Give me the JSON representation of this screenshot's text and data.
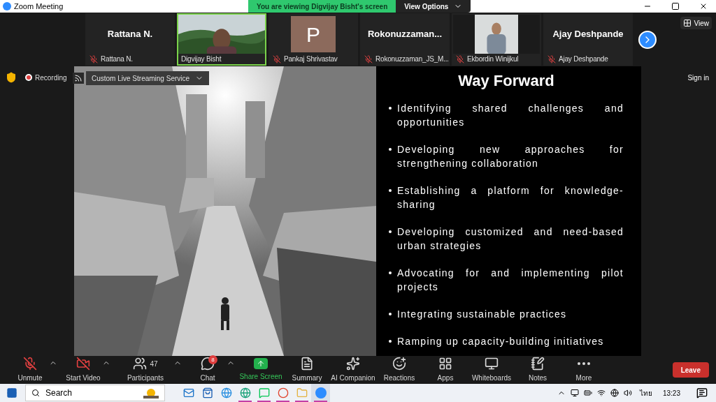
{
  "window": {
    "title": "Zoom Meeting",
    "banner": "You are viewing Digvijay Bisht's screen",
    "view_options": "View Options"
  },
  "gallery": {
    "view_button": "View",
    "tiles": [
      {
        "kind": "name",
        "display": "Rattana N.",
        "name": "Rattana N.",
        "muted": true,
        "speaking": false
      },
      {
        "kind": "video",
        "name": "Digvijay Bisht",
        "muted": false,
        "speaking": true
      },
      {
        "kind": "avatar",
        "display": "P",
        "name": "Pankaj Shrivastav",
        "muted": true,
        "speaking": false
      },
      {
        "kind": "name",
        "display": "Rokonuzzaman...",
        "name": "Rokonuzzaman_JS_M...",
        "muted": true,
        "speaking": false
      },
      {
        "kind": "video",
        "name": "Ekbordin Winijkul",
        "muted": true,
        "speaking": false
      },
      {
        "kind": "name",
        "display": "Ajay Deshpande",
        "name": "Ajay Deshpande",
        "muted": true,
        "speaking": false
      }
    ]
  },
  "share": {
    "recording": "Recording",
    "stream_service": "Custom Live Streaming Service",
    "sign_in": "Sign in"
  },
  "slide": {
    "title": "Way Forward",
    "bullets": [
      "Identifying shared challenges and opportunities",
      "Developing new approaches for strengthening collaboration",
      "Establishing a platform for knowledge-sharing",
      "Developing customized and need-based urban strategies",
      "Advocating for and implementing pilot projects",
      "Integrating sustainable practices",
      "Ramping up capacity-building initiatives"
    ]
  },
  "toolbar": {
    "items": [
      {
        "kind": "mic",
        "label": "Unmute",
        "caret": true,
        "off": true
      },
      {
        "kind": "video",
        "label": "Start Video",
        "caret": true,
        "off": true
      },
      {
        "kind": "participants",
        "label": "Participants",
        "caret": true,
        "off": false,
        "count": "47"
      },
      {
        "kind": "chat",
        "label": "Chat",
        "caret": true,
        "off": false,
        "badge": "8"
      },
      {
        "kind": "share",
        "label": "Share Screen",
        "caret": false
      },
      {
        "kind": "summary",
        "label": "Summary",
        "caret": false
      },
      {
        "kind": "ai",
        "label": "AI Companion",
        "caret": false
      },
      {
        "kind": "reactions",
        "label": "Reactions",
        "caret": false
      },
      {
        "kind": "apps",
        "label": "Apps",
        "caret": false
      },
      {
        "kind": "whiteboards",
        "label": "Whiteboards",
        "caret": false
      },
      {
        "kind": "notes",
        "label": "Notes",
        "caret": false
      },
      {
        "kind": "more",
        "label": "More",
        "caret": false
      }
    ],
    "leave": "Leave"
  },
  "taskbar": {
    "search": "Search",
    "apps": [
      {
        "kind": "mail",
        "running": false,
        "selected": false
      },
      {
        "kind": "store",
        "running": false,
        "selected": false
      },
      {
        "kind": "ie",
        "running": false,
        "selected": false
      },
      {
        "kind": "edge",
        "running": true,
        "selected": false
      },
      {
        "kind": "line",
        "running": true,
        "selected": false
      },
      {
        "kind": "chrome",
        "running": true,
        "selected": false
      },
      {
        "kind": "folder",
        "running": true,
        "selected": false
      },
      {
        "kind": "zoom",
        "running": true,
        "selected": true
      }
    ],
    "language": "ไทย",
    "time": "13:23"
  }
}
